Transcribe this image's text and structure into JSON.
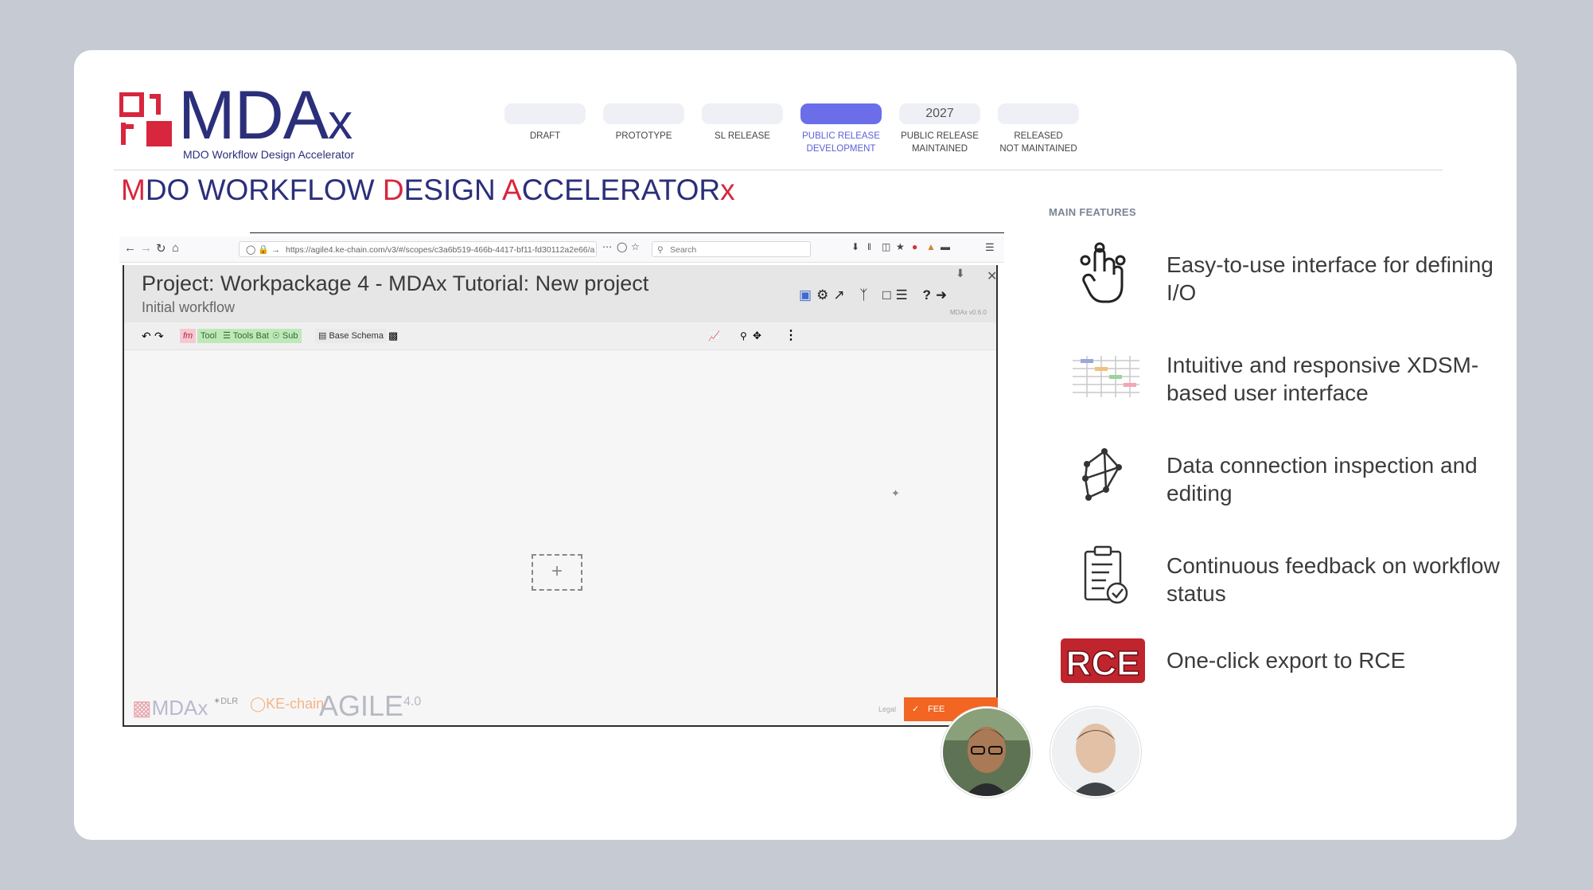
{
  "logo": {
    "name": "MDA",
    "name_x": "x",
    "tagline": "MDO Workflow Design Accelerator"
  },
  "stages": [
    {
      "pill": "",
      "label_lines": [
        "DRAFT"
      ],
      "active": false
    },
    {
      "pill": "",
      "label_lines": [
        "PROTOTYPE"
      ],
      "active": false
    },
    {
      "pill": "",
      "label_lines": [
        "SL RELEASE"
      ],
      "active": false
    },
    {
      "pill": "",
      "label_lines": [
        "PUBLIC RELEASE",
        "DEVELOPMENT"
      ],
      "active": true
    },
    {
      "pill": "2027",
      "label_lines": [
        "PUBLIC RELEASE",
        "MAINTAINED"
      ],
      "active": false
    },
    {
      "pill": "",
      "label_lines": [
        "RELEASED",
        "NOT MAINTAINED"
      ],
      "active": false
    }
  ],
  "title": {
    "m": "M",
    "p1": "DO WORKFLOW ",
    "d": "D",
    "p2": "ESIGN ",
    "a": "A",
    "p3": "CCELERATOR",
    "x": "x"
  },
  "browser": {
    "url": "https://agile4.ke-chain.com/v3/#/scopes/c3a6b519-466b-4417-bf11-fd30112a2e66/a",
    "search_placeholder": "Search"
  },
  "app": {
    "project_title": "Project: Workpackage 4 - MDAx Tutorial: New project",
    "subtitle": "Initial workflow",
    "version": "MDAx v0.6.0",
    "toolbar": {
      "fm": "fm",
      "tool": "Tool",
      "tools_batch": "Tools Batch",
      "sub": "Sub",
      "base_schema": "Base Schema"
    },
    "footer": {
      "mdax": "MDAx",
      "dlr": "DLR",
      "kechain": "KE-chain",
      "agile": "AGILE",
      "agile_ver": "4.0",
      "legal": "Legal",
      "feedback": "FEE"
    }
  },
  "features_title": "MAIN FEATURES",
  "features": [
    {
      "icon": "touch-gesture-icon",
      "text": "Easy-to-use interface for defining I/O"
    },
    {
      "icon": "xsdm-diagram-icon",
      "text": "Intuitive and responsive XDSM-based user interface"
    },
    {
      "icon": "data-connection-icon",
      "text": "Data connection inspection and editing"
    },
    {
      "icon": "clipboard-check-icon",
      "text": "Continuous feedback on workflow status"
    },
    {
      "icon": "rce-logo-icon",
      "text": "One-click export to RCE"
    }
  ],
  "colors": {
    "brand_navy": "#2b2f7a",
    "brand_red": "#d7263d",
    "active_stage": "#6b6ee8",
    "feedback_orange": "#f26522"
  }
}
